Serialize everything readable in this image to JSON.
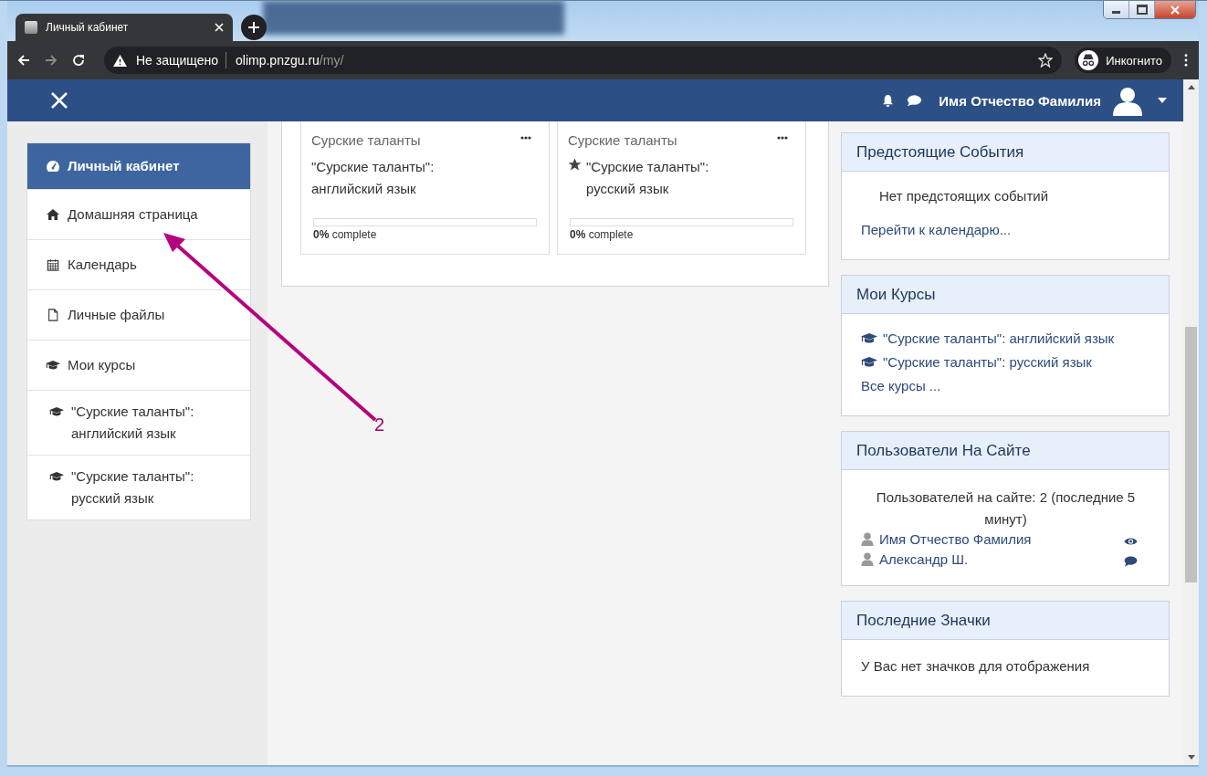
{
  "browser": {
    "tab_title": "Личный кабинет",
    "security_label": "Не защищено",
    "url_host": "olimp.pnzgu.ru",
    "url_path": "/my/",
    "incognito_label": "Инкогнито"
  },
  "navbar": {
    "user_name": "Имя Отчество Фамилия"
  },
  "sidebar": {
    "items": [
      {
        "label": "Личный кабинет",
        "kind": "dashboard",
        "selected": true
      },
      {
        "label": "Домашняя страница",
        "kind": "home",
        "selected": false
      },
      {
        "label": "Календарь",
        "kind": "calendar",
        "selected": false
      },
      {
        "label": "Личные файлы",
        "kind": "file",
        "selected": false
      },
      {
        "label": "Мои курсы",
        "kind": "courses",
        "selected": false
      },
      {
        "label": "\"Сурские таланты\": английский язык",
        "kind": "course",
        "selected": false
      },
      {
        "label": "\"Сурские таланты\": русский язык",
        "kind": "course",
        "selected": false
      }
    ]
  },
  "courses": [
    {
      "category": "Сурские таланты",
      "title": "\"Сурские таланты\": английский язык",
      "starred": false,
      "level": 0,
      "progress_text": "**0%** complete"
    },
    {
      "category": "Сурские таланты",
      "title": "\"Сурские таланты\": русский язык",
      "starred": true,
      "level": 0,
      "progress_text": "**0%** complete"
    }
  ],
  "blocks": [
    {
      "title": "Предстоящие События",
      "kind": "events",
      "text": "Нет предстоящих событий",
      "link": "Перейти к календарю..."
    },
    {
      "title": "Мои Курсы",
      "kind": "courses",
      "items": [
        "\"Сурские таланты\": английский язык",
        "\"Сурские таланты\": русский язык"
      ],
      "link": "Все курсы ..."
    },
    {
      "title": "Пользователи На Сайте",
      "kind": "users",
      "summary": "Пользователей на сайте: 2 (последние 5 минут)",
      "users": [
        {
          "name": "Имя Отчество Фамилия",
          "kind": "self"
        },
        {
          "name": "Александр Ш.",
          "kind": "other"
        }
      ]
    },
    {
      "title": "Последние Значки",
      "kind": "text",
      "text": "У Вас нет значков для отображения"
    }
  ],
  "annotation": {
    "label": "2"
  }
}
